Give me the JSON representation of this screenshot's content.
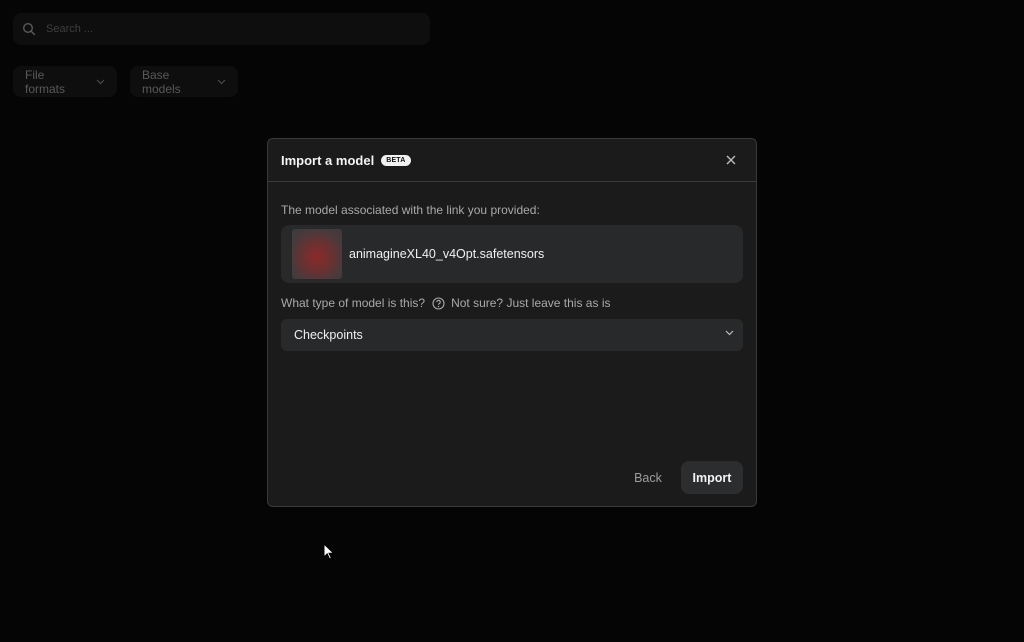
{
  "background": {
    "search": {
      "placeholder": "Search ..."
    },
    "filters": [
      {
        "label": "File formats"
      },
      {
        "label": "Base models"
      }
    ]
  },
  "modal": {
    "title": "Import a model",
    "badge": "BETA",
    "associated_label": "The model associated with the link you provided:",
    "model": {
      "filename": "animagineXL40_v4Opt.safetensors"
    },
    "type_question": "What type of model is this?",
    "type_hint": "Not sure? Just leave this as is",
    "type_select": {
      "selected": "Checkpoints"
    },
    "back_label": "Back",
    "import_label": "Import"
  },
  "icons": {
    "search": "search-icon",
    "chevron": "chevron-down-icon",
    "close": "close-icon",
    "help": "help-circle-icon",
    "cursor": "mouse-cursor"
  },
  "colors": {
    "page_bg": "#050505",
    "modal_bg": "#1b1b1b",
    "card_bg": "#28292a",
    "border": "#3a3a3a"
  }
}
